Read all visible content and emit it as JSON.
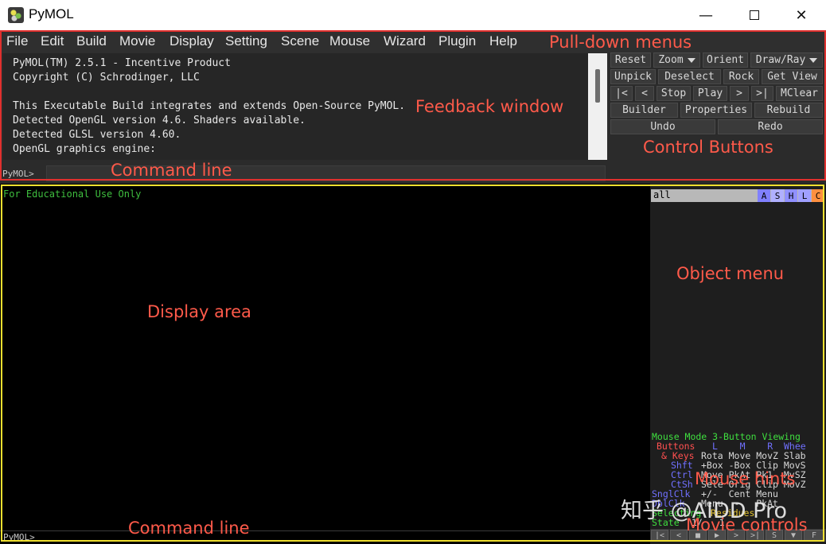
{
  "window": {
    "title": "PyMOL",
    "minimize_glyph": "—",
    "close_glyph": "✕"
  },
  "menubar": {
    "items": [
      "File",
      "Edit",
      "Build",
      "Movie",
      "Display",
      "Setting",
      "Scene",
      "Mouse",
      "Wizard",
      "Plugin",
      "Help"
    ]
  },
  "feedback": {
    "lines": [
      "PyMOL(TM) 2.5.1 - Incentive Product",
      "Copyright (C) Schrodinger, LLC",
      "",
      "This Executable Build integrates and extends Open-Source PyMOL.",
      "Detected OpenGL version 4.6. Shaders available.",
      "Detected GLSL version 4.60.",
      "OpenGL graphics engine:"
    ]
  },
  "command": {
    "prompt": "PyMOL>",
    "value": ""
  },
  "controls": {
    "reset": "Reset",
    "zoom": "Zoom",
    "orient": "Orient",
    "draw_ray": "Draw/Ray",
    "unpick": "Unpick",
    "deselect": "Deselect",
    "rock": "Rock",
    "get_view": "Get View",
    "first": "|<",
    "prev": "<",
    "stop": "Stop",
    "play": "Play",
    "next": ">",
    "last": ">|",
    "mclear": "MClear",
    "builder": "Builder",
    "properties": "Properties",
    "rebuild": "Rebuild",
    "undo": "Undo",
    "redo": "Redo"
  },
  "display": {
    "overlay_text": "For Educational Use Only"
  },
  "object_menu": {
    "name": "all",
    "buttons": [
      {
        "label": "A",
        "color": "#8080ff"
      },
      {
        "label": "S",
        "color": "#b0b0ff"
      },
      {
        "label": "H",
        "color": "#9090ff"
      },
      {
        "label": "L",
        "color": "#a0a0ff"
      },
      {
        "label": "C",
        "color": "#ff9040"
      }
    ]
  },
  "mouse_hints": {
    "header": "Mouse Mode 3-Button Viewing",
    "buttons_label": "Buttons",
    "buttons_cols": "L    M    R  Whee",
    "keys_label": "& Keys",
    "keys_cols": "Rota Move MovZ Slab",
    "shft_label": "Shft",
    "shft_cols": "+Box -Box Clip MovS",
    "ctrl_label": "Ctrl",
    "ctrl_cols": "Move PkAt Pk1  MvSZ",
    "ctsh_label": "CtSh",
    "ctsh_cols": "Sele Orig Clip MovZ",
    "sngl_label": "SnglClk",
    "sngl_cols": "+/-  Cent Menu",
    "dbl_label": "DblClk",
    "dbl_cols": "Menu  -   PkAt",
    "selecting_label": "Selecting",
    "selecting_value": "Residues",
    "state_label": "State",
    "state_value": "1/   1"
  },
  "movie_controls": {
    "buttons": [
      "|<",
      "<",
      "■",
      "▶",
      ">",
      ">|",
      "S",
      "▼",
      "F"
    ]
  },
  "annotations": {
    "pulldown": "Pull-down menus",
    "feedback": "Feedback window",
    "control": "Control Buttons",
    "cmd_upper": "Command line",
    "object_menu": "Object menu",
    "display_area": "Display area",
    "mouse_hints": "Mouse hints",
    "cmd_lower": "Command line",
    "movie_controls": "Movie controls"
  },
  "watermark": "知乎 @AIDD Pro",
  "colors": {
    "annotation_red": "#ff5a4a",
    "upper_frame": "#e0302e",
    "lower_frame": "#f0e030",
    "edu_text": "#3fbf3f"
  }
}
